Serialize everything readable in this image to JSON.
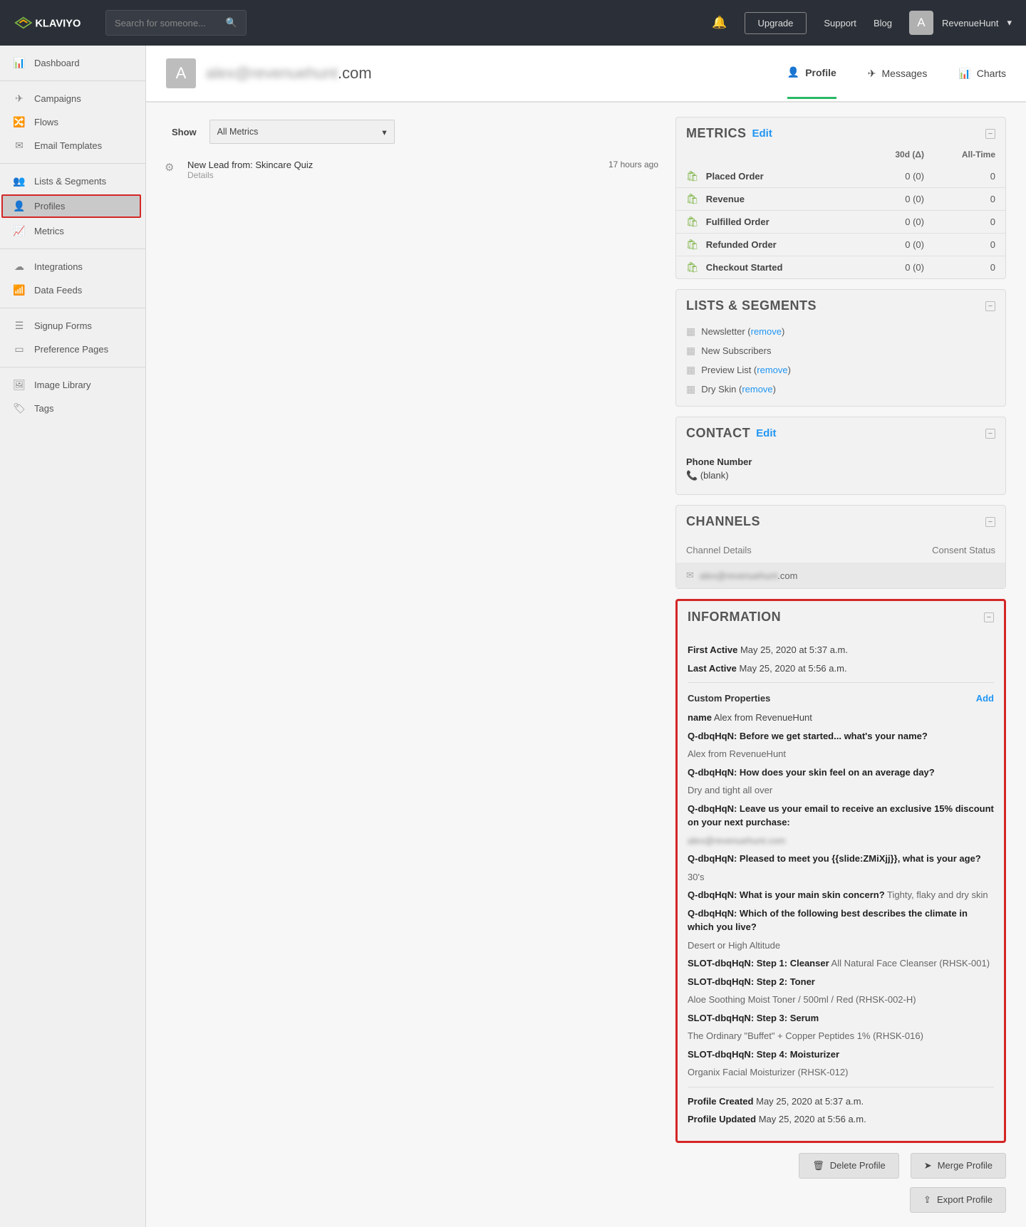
{
  "header": {
    "brand": "KLAVIYO",
    "search_placeholder": "Search for someone...",
    "upgrade": "Upgrade",
    "support": "Support",
    "blog": "Blog",
    "avatar_letter": "A",
    "account": "RevenueHunt"
  },
  "sidebar": {
    "groups": [
      {
        "items": [
          {
            "icon": "dashboard-icon",
            "label": "Dashboard"
          }
        ]
      },
      {
        "items": [
          {
            "icon": "send-icon",
            "label": "Campaigns"
          },
          {
            "icon": "flow-icon",
            "label": "Flows"
          },
          {
            "icon": "envelope-icon",
            "label": "Email Templates"
          }
        ]
      },
      {
        "items": [
          {
            "icon": "users-icon",
            "label": "Lists & Segments"
          },
          {
            "icon": "user-icon",
            "label": "Profiles",
            "active": true
          },
          {
            "icon": "chart-icon",
            "label": "Metrics"
          }
        ]
      },
      {
        "items": [
          {
            "icon": "cloud-icon",
            "label": "Integrations"
          },
          {
            "icon": "feed-icon",
            "label": "Data Feeds"
          }
        ]
      },
      {
        "items": [
          {
            "icon": "form-icon",
            "label": "Signup Forms"
          },
          {
            "icon": "page-icon",
            "label": "Preference Pages"
          }
        ]
      },
      {
        "items": [
          {
            "icon": "image-icon",
            "label": "Image Library"
          },
          {
            "icon": "tag-icon",
            "label": "Tags"
          }
        ]
      }
    ]
  },
  "profile": {
    "avatar": "A",
    "email_blurred": "alex@revenuehunt",
    "email_suffix": ".com",
    "tabs": {
      "profile": "Profile",
      "messages": "Messages",
      "charts": "Charts"
    }
  },
  "show": {
    "label": "Show",
    "metrics_select": "All Metrics"
  },
  "activity": {
    "title": "New Lead from: Skincare Quiz",
    "details": "Details",
    "time": "17 hours ago"
  },
  "metrics": {
    "title": "METRICS",
    "edit": "Edit",
    "col30d": "30d (Δ)",
    "colAll": "All-Time",
    "rows": [
      {
        "name": "Placed Order",
        "d30": "0 (0)",
        "all": "0"
      },
      {
        "name": "Revenue",
        "d30": "0 (0)",
        "all": "0"
      },
      {
        "name": "Fulfilled Order",
        "d30": "0 (0)",
        "all": "0"
      },
      {
        "name": "Refunded Order",
        "d30": "0 (0)",
        "all": "0"
      },
      {
        "name": "Checkout Started",
        "d30": "0 (0)",
        "all": "0"
      }
    ]
  },
  "lists": {
    "title": "LISTS & SEGMENTS",
    "rows": [
      {
        "name": "Newsletter",
        "remove": true
      },
      {
        "name": "New Subscribers",
        "remove": false
      },
      {
        "name": "Preview List",
        "remove": true
      },
      {
        "name": "Dry Skin",
        "remove": true
      }
    ],
    "remove_label": "remove"
  },
  "contact": {
    "title": "CONTACT",
    "edit": "Edit",
    "phone_label": "Phone Number",
    "phone_value": "(blank)"
  },
  "channels": {
    "title": "CHANNELS",
    "details": "Channel Details",
    "consent": "Consent Status",
    "email_blurred": "alex@revenuehunt",
    "email_suffix": ".com"
  },
  "info": {
    "title": "INFORMATION",
    "first_active_label": "First Active",
    "first_active": "May 25, 2020 at 5:37 a.m.",
    "last_active_label": "Last Active",
    "last_active": "May 25, 2020 at 5:56 a.m.",
    "custom_header": "Custom Properties",
    "add": "Add",
    "name_label": "name",
    "name_value": "Alex from RevenueHunt",
    "q1_label": "Q-dbqHqN: Before we get started... what's your name?",
    "q1_answer": "Alex from RevenueHunt",
    "q2_label": "Q-dbqHqN: How does your skin feel on an average day?",
    "q2_answer": "Dry and tight all over",
    "q3_label": "Q-dbqHqN: Leave us your email to receive an exclusive 15% discount on your next purchase:",
    "q3_answer_blurred": "alex@revenuehunt.com",
    "q4_label": "Q-dbqHqN: Pleased to meet you {{slide:ZMiXjj}}, what is your age?",
    "q4_answer": "30's",
    "q5_label": "Q-dbqHqN: What is your main skin concern?",
    "q5_answer": "Tighty, flaky and dry skin",
    "q6_label": "Q-dbqHqN: Which of the following best describes the climate in which you live?",
    "q6_answer": "Desert or High Altitude",
    "s1_label": "SLOT-dbqHqN: Step 1: Cleanser",
    "s1_value": "All Natural Face Cleanser (RHSK-001)",
    "s2_label": "SLOT-dbqHqN: Step 2: Toner",
    "s2_value": "Aloe Soothing Moist Toner / 500ml / Red (RHSK-002-H)",
    "s3_label": "SLOT-dbqHqN: Step 3: Serum",
    "s3_value": "The Ordinary \"Buffet\" + Copper Peptides 1% (RHSK-016)",
    "s4_label": "SLOT-dbqHqN: Step 4: Moisturizer",
    "s4_value": "Organix Facial Moisturizer (RHSK-012)",
    "created_label": "Profile Created",
    "created": "May 25, 2020 at 5:37 a.m.",
    "updated_label": "Profile Updated",
    "updated": "May 25, 2020 at 5:56 a.m."
  },
  "actions": {
    "delete": "Delete Profile",
    "merge": "Merge Profile",
    "export": "Export Profile"
  }
}
